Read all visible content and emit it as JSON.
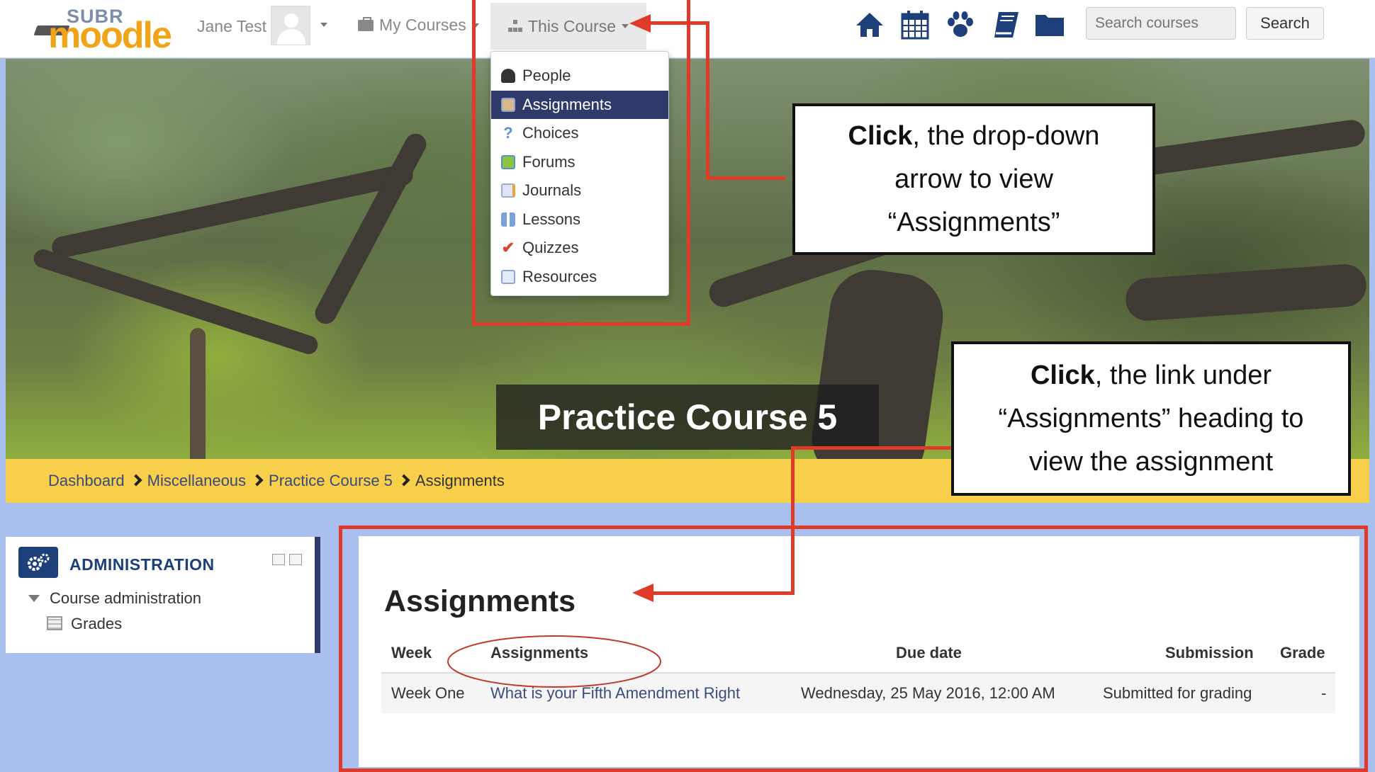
{
  "navbar": {
    "logo_top": "SUBR",
    "logo_bottom": "moodle",
    "username": "Jane Test",
    "my_courses_label": "My Courses",
    "this_course_label": "This Course",
    "search_placeholder": "Search courses",
    "search_button": "Search",
    "icons": [
      "home-icon",
      "calendar-icon",
      "paw-icon",
      "book-icon",
      "folder-icon"
    ]
  },
  "course_menu": {
    "items": [
      {
        "label": "People",
        "icon": "people-icon"
      },
      {
        "label": "Assignments",
        "icon": "assignment-icon",
        "active": true
      },
      {
        "label": "Choices",
        "icon": "question-icon"
      },
      {
        "label": "Forums",
        "icon": "forum-icon"
      },
      {
        "label": "Journals",
        "icon": "journal-icon"
      },
      {
        "label": "Lessons",
        "icon": "lesson-icon"
      },
      {
        "label": "Quizzes",
        "icon": "quiz-icon"
      },
      {
        "label": "Resources",
        "icon": "resource-icon"
      }
    ]
  },
  "hero": {
    "course_title": "Practice Course 5"
  },
  "breadcrumb": [
    "Dashboard",
    "Miscellaneous",
    "Practice Course 5",
    "Assignments"
  ],
  "admin_block": {
    "title": "ADMINISTRATION",
    "course_admin": "Course administration",
    "grades": "Grades"
  },
  "main": {
    "heading": "Assignments",
    "columns": [
      "Week",
      "Assignments",
      "Due date",
      "Submission",
      "Grade"
    ],
    "rows": [
      {
        "week": "Week One",
        "assignment": "What is your Fifth Amendment Right",
        "due": "Wednesday, 25 May 2016, 12:00 AM",
        "submission": "Submitted for grading",
        "grade": "-"
      }
    ]
  },
  "annotations": {
    "callout1_bold": "Click",
    "callout1_line1": ", the drop-down",
    "callout1_line2": "arrow to view",
    "callout1_line3": "“Assignments”",
    "callout2_bold": "Click",
    "callout2_line1": ", the link under",
    "callout2_line2": "“Assignments” heading to",
    "callout2_line3": "view the assignment"
  },
  "colors": {
    "accent_red": "#e03a2a",
    "breadcrumb_yellow": "#f7cf4a",
    "navy": "#303a6a",
    "brand_orange": "#f2a418"
  }
}
